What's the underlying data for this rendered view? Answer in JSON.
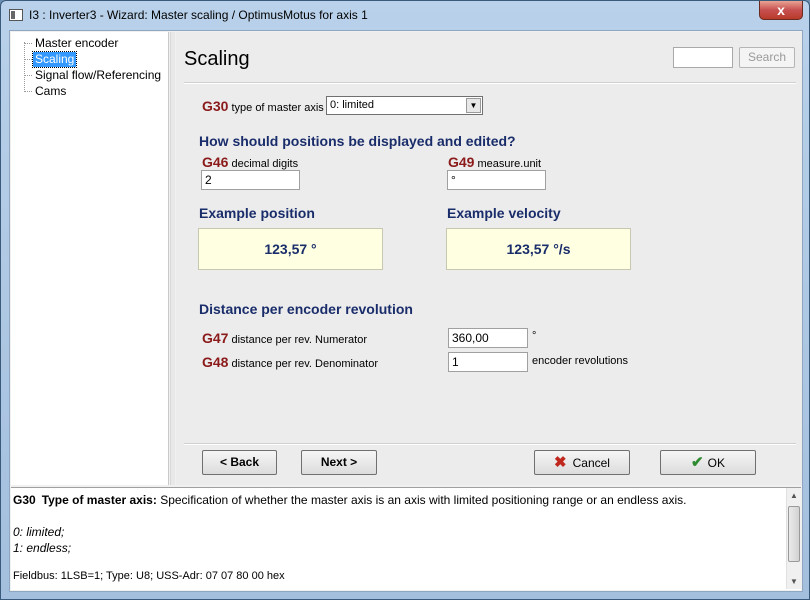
{
  "window": {
    "title": "I3 : Inverter3 - Wizard: Master scaling / OptimusMotus for axis 1",
    "close_label": "x"
  },
  "tree": {
    "items": [
      {
        "label": "Master encoder",
        "selected": false
      },
      {
        "label": "Scaling",
        "selected": true
      },
      {
        "label": "Signal flow/Referencing",
        "selected": false
      },
      {
        "label": "Cams",
        "selected": false
      }
    ]
  },
  "page": {
    "title": "Scaling",
    "search": {
      "value": "",
      "button_label": "Search"
    }
  },
  "g30": {
    "code": "G30",
    "label": "type of master axis",
    "selected_value": "0: limited",
    "arrow_icon": "chevron-down-icon"
  },
  "display_section": {
    "heading": "How should positions be displayed and edited?",
    "g46": {
      "code": "G46",
      "label": "decimal digits",
      "value": "2"
    },
    "g49": {
      "code": "G49",
      "label": "measure.unit",
      "value": "°"
    }
  },
  "examples": {
    "position_heading": "Example position",
    "position_value": "123,57 °",
    "velocity_heading": "Example velocity",
    "velocity_value": "123,57 °/s"
  },
  "distance_section": {
    "heading": "Distance per encoder revolution",
    "g47": {
      "code": "G47",
      "label": "distance per rev. Numerator",
      "value": "360,00",
      "unit": "°"
    },
    "g48": {
      "code": "G48",
      "label": "distance per rev. Denominator",
      "value": "1",
      "unit": "encoder revolutions"
    }
  },
  "buttons": {
    "back": "< Back",
    "next": "Next >",
    "cancel": "Cancel",
    "ok": "OK"
  },
  "help": {
    "code": "G30",
    "title": "Type of master axis:",
    "description": "Specification of whether the master axis is an axis with limited positioning range or an endless axis.",
    "options": [
      "0:  limited;",
      "1:  endless;"
    ],
    "footer": "Fieldbus: 1LSB=1; Type: U8; USS-Adr: 07 07 80 00 hex"
  },
  "colors": {
    "param_code": "#8b1a1a",
    "heading": "#1a2d6b",
    "example_bg": "#ffffe1",
    "selection": "#3399ff"
  }
}
